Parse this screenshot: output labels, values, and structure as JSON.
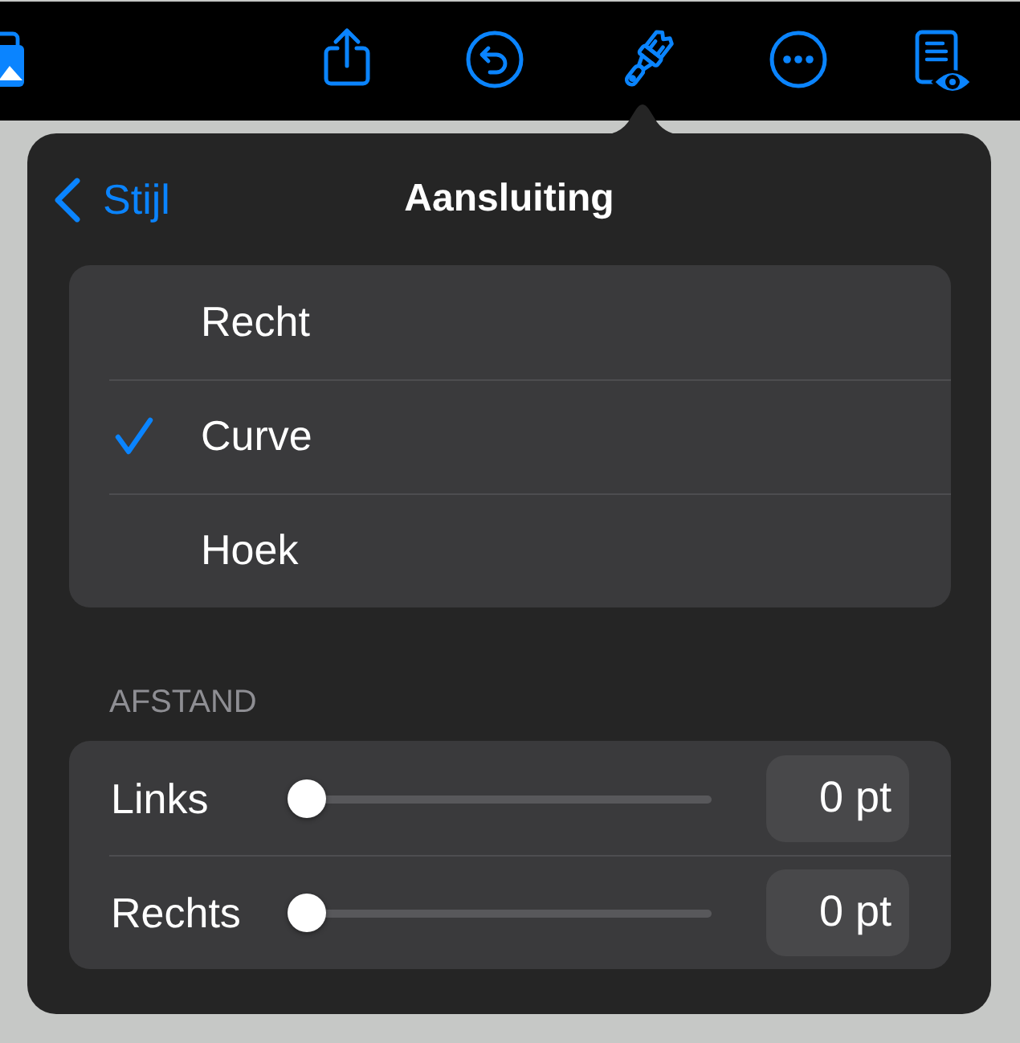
{
  "popover": {
    "back_button": {
      "label": "Stijl"
    },
    "title": "Aansluiting",
    "options": [
      {
        "label": "Recht",
        "selected": false
      },
      {
        "label": "Curve",
        "selected": true
      },
      {
        "label": "Hoek",
        "selected": false
      }
    ],
    "spacing": {
      "heading": "AFSTAND",
      "rows": [
        {
          "label": "Links",
          "level": 0,
          "value": "0 pt"
        },
        {
          "label": "Rechts",
          "level": 0,
          "value": "0 pt"
        }
      ]
    }
  }
}
